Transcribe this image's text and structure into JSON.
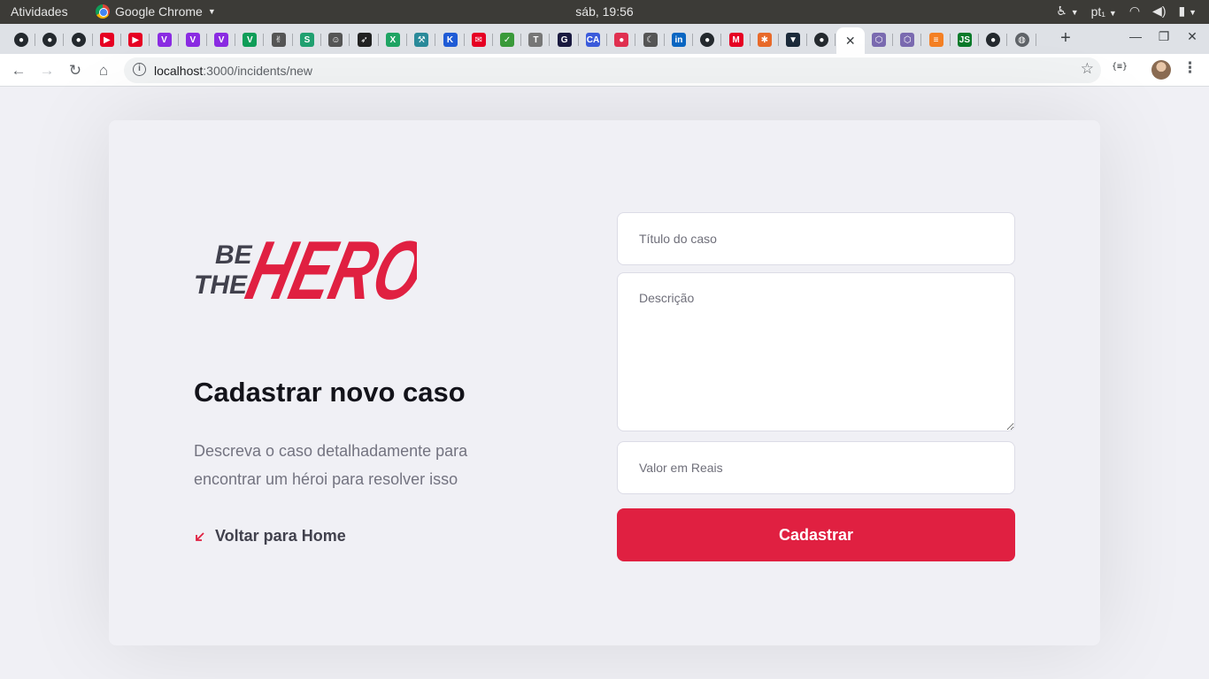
{
  "system_bar": {
    "activities": "Atividades",
    "app_name": "Google Chrome",
    "clock": "sáb, 19:56",
    "language": "pt₁"
  },
  "browser": {
    "url_host": "localhost",
    "url_path": ":3000/incidents/new",
    "extension_label": "{≡}",
    "tabs": [
      {
        "icon": "github-icon",
        "color": "#24292e",
        "glyph": "●"
      },
      {
        "icon": "github-icon",
        "color": "#24292e",
        "glyph": "●"
      },
      {
        "icon": "github-icon",
        "color": "#24292e",
        "glyph": "●"
      },
      {
        "icon": "youtube-music-icon",
        "color": "#e60023",
        "glyph": "▶"
      },
      {
        "icon": "youtube-music-icon",
        "color": "#e60023",
        "glyph": "▶"
      },
      {
        "icon": "v-icon",
        "color": "#8a2be2",
        "glyph": "V"
      },
      {
        "icon": "v-icon",
        "color": "#8a2be2",
        "glyph": "V"
      },
      {
        "icon": "v-icon",
        "color": "#8a2be2",
        "glyph": "V"
      },
      {
        "icon": "vue-icon",
        "color": "#0f9d58",
        "glyph": "V"
      },
      {
        "icon": "hand-icon",
        "color": "#555555",
        "glyph": "✌"
      },
      {
        "icon": "s-icon",
        "color": "#20a070",
        "glyph": "S"
      },
      {
        "icon": "people-icon",
        "color": "#555555",
        "glyph": "☺"
      },
      {
        "icon": "rocket-icon",
        "color": "#222222",
        "glyph": "➶"
      },
      {
        "icon": "x-icon",
        "color": "#1fa463",
        "glyph": "X"
      },
      {
        "icon": "tool-icon",
        "color": "#2a8a9a",
        "glyph": "⚒"
      },
      {
        "icon": "k-icon",
        "color": "#1f5bd6",
        "glyph": "K"
      },
      {
        "icon": "chat-icon",
        "color": "#e60023",
        "glyph": "✉"
      },
      {
        "icon": "check-icon",
        "color": "#3a9a3a",
        "glyph": "✓"
      },
      {
        "icon": "t-icon",
        "color": "#777777",
        "glyph": "T"
      },
      {
        "icon": "g-icon",
        "color": "#1a1a40",
        "glyph": "G"
      },
      {
        "icon": "ca-icon",
        "color": "#3b5bdb",
        "glyph": "CA"
      },
      {
        "icon": "pill-icon",
        "color": "#e03050",
        "glyph": "●"
      },
      {
        "icon": "moon-icon",
        "color": "#555555",
        "glyph": "☾"
      },
      {
        "icon": "linkedin-icon",
        "color": "#0a66c2",
        "glyph": "in"
      },
      {
        "icon": "github-icon",
        "color": "#24292e",
        "glyph": "●"
      },
      {
        "icon": "m-icon",
        "color": "#e60023",
        "glyph": "M"
      },
      {
        "icon": "asterisk-icon",
        "color": "#e86a2a",
        "glyph": "✱"
      },
      {
        "icon": "vuetify-icon",
        "color": "#1b2a3a",
        "glyph": "▼"
      },
      {
        "icon": "github-icon",
        "color": "#24292e",
        "glyph": "●"
      },
      {
        "icon": "close-icon",
        "color": "#3c4043",
        "glyph": "✕",
        "active": true
      },
      {
        "icon": "cube-icon",
        "color": "#7a6ab0",
        "glyph": "⬡"
      },
      {
        "icon": "cube-icon",
        "color": "#7a6ab0",
        "glyph": "⬡"
      },
      {
        "icon": "stack-icon",
        "color": "#f48024",
        "glyph": "≡"
      },
      {
        "icon": "js-icon",
        "color": "#0a7a2a",
        "glyph": "JS"
      },
      {
        "icon": "github-icon",
        "color": "#24292e",
        "glyph": "●"
      },
      {
        "icon": "globe-icon",
        "color": "#5f6368",
        "glyph": "◍"
      }
    ]
  },
  "page": {
    "logo": {
      "line1": "BE",
      "line2": "THE",
      "line3": "HERO"
    },
    "title": "Cadastrar novo caso",
    "description": "Descreva o caso detalhadamente para encontrar um héroi para resolver isso",
    "back_link": "Voltar para Home",
    "form": {
      "title_placeholder": "Título do caso",
      "description_placeholder": "Descrição",
      "value_placeholder": "Valor em Reais",
      "submit_label": "Cadastrar"
    }
  },
  "colors": {
    "accent": "#e02041",
    "background": "#f0f0f5",
    "text_dark": "#13131a",
    "text_muted": "#737380"
  }
}
